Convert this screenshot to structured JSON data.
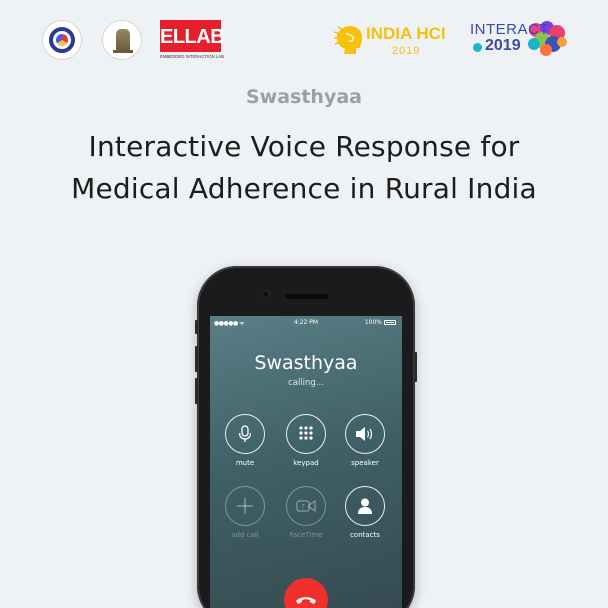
{
  "logos": {
    "ellab_text": "ELLAB",
    "ellab_subtitle": "EMBEDDED INTERACTION LAB",
    "indiahci_name": "INDIA HCI",
    "indiahci_year": "2019",
    "interact_name": "INTERACT",
    "interact_year": "2019"
  },
  "brand": "Swasthyaa",
  "title_line1": "Interactive Voice Response for",
  "title_line2": "Medical Adherence in Rural India",
  "phone": {
    "status_bar": {
      "time": "4:22 PM",
      "battery": "100%"
    },
    "caller_name": "Swasthyaa",
    "call_status": "calling...",
    "controls": [
      {
        "label": "mute",
        "icon": "microphone-icon",
        "enabled": true
      },
      {
        "label": "keypad",
        "icon": "keypad-icon",
        "enabled": true
      },
      {
        "label": "speaker",
        "icon": "speaker-icon",
        "enabled": true
      },
      {
        "label": "add call",
        "icon": "plus-icon",
        "enabled": false
      },
      {
        "label": "FaceTime",
        "icon": "facetime-icon",
        "enabled": false
      },
      {
        "label": "contacts",
        "icon": "contacts-icon",
        "enabled": true
      }
    ],
    "end_call_icon": "end-call-icon"
  },
  "colors": {
    "background": "#eef2f4",
    "end_call": "#f0302c",
    "ellab_red": "#e51f2b",
    "indiahci_yellow": "#f4c20d",
    "interact_blue": "#3b4aa6"
  }
}
